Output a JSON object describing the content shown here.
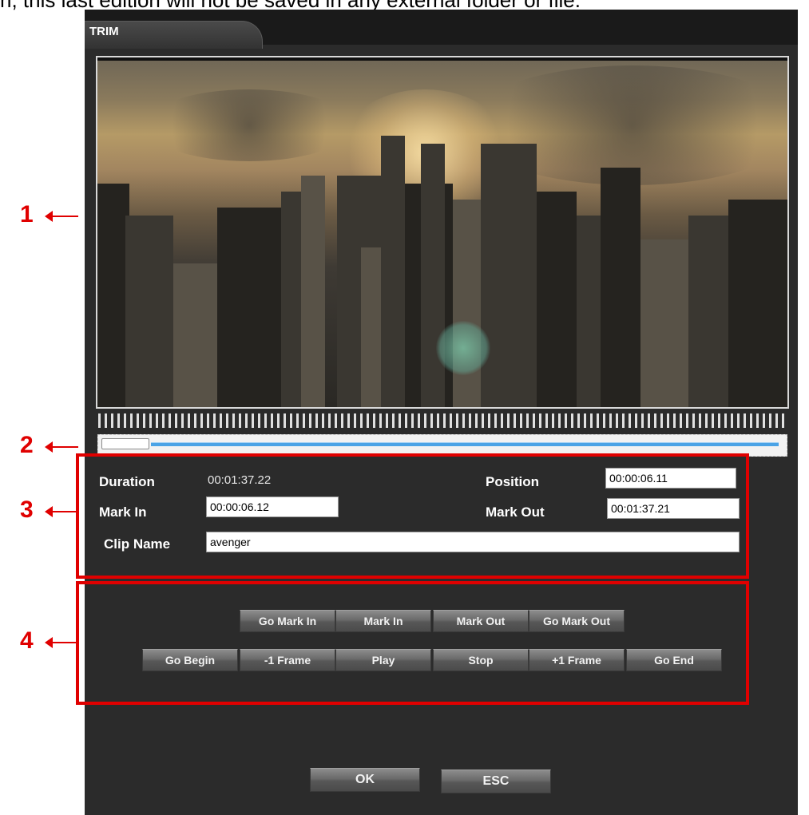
{
  "doc_text": "n, this last edition will not be saved in any external folder or file.",
  "window": {
    "tab_title": "TRIM"
  },
  "callouts": [
    "1",
    "2",
    "3",
    "4"
  ],
  "info": {
    "duration_label": "Duration",
    "duration_value": "00:01:37.22",
    "position_label": "Position",
    "position_value": "00:00:06.11",
    "mark_in_label": "Mark In",
    "mark_in_value": "00:00:06.12",
    "mark_out_label": "Mark Out",
    "mark_out_value": "00:01:37.21",
    "clip_name_label": "Clip Name",
    "clip_name_value": "avenger"
  },
  "slider": {
    "position_fraction": 0.07
  },
  "controls": {
    "row1": [
      "Go Mark In",
      "Mark In",
      "Mark Out",
      "Go Mark Out"
    ],
    "row2": [
      "Go Begin",
      "-1 Frame",
      "Play",
      "Stop",
      "+1 Frame",
      "Go End"
    ]
  },
  "dialog": {
    "ok": "OK",
    "esc": "ESC"
  },
  "colors": {
    "annotation": "#e00000",
    "panel": "#2b2b2b",
    "track": "#4aa3e6"
  }
}
